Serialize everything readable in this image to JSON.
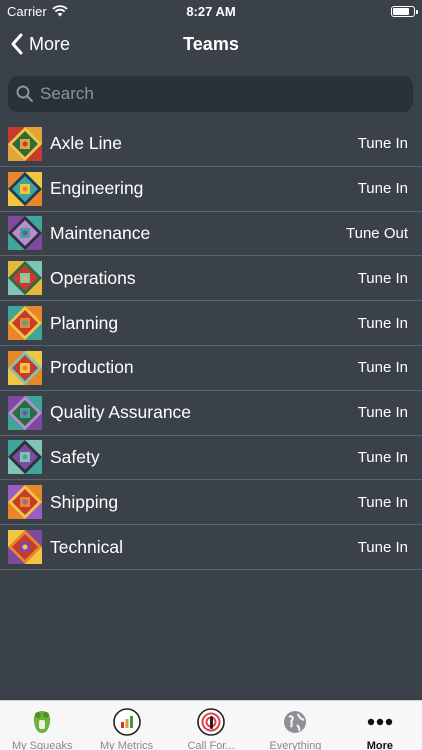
{
  "status_bar": {
    "carrier": "Carrier",
    "time": "8:27 AM"
  },
  "nav": {
    "back_label": "More",
    "title": "Teams"
  },
  "search": {
    "placeholder": "Search",
    "value": ""
  },
  "teams": [
    {
      "name": "Axle Line",
      "action": "Tune In",
      "icon_palette": [
        "#c63a2f",
        "#e3a43a",
        "#2b6b3f",
        "#f2c542"
      ]
    },
    {
      "name": "Engineering",
      "action": "Tune In",
      "icon_palette": [
        "#e8862c",
        "#f2c542",
        "#3fa59b",
        "#1f3b5a"
      ]
    },
    {
      "name": "Maintenance",
      "action": "Tune Out",
      "icon_palette": [
        "#7d4aa0",
        "#3fa59b",
        "#b98bd0",
        "#2d2f35"
      ]
    },
    {
      "name": "Operations",
      "action": "Tune In",
      "icon_palette": [
        "#e7b93b",
        "#7fc5b3",
        "#c63a2f",
        "#2b6b3f"
      ]
    },
    {
      "name": "Planning",
      "action": "Tune In",
      "icon_palette": [
        "#3fa59b",
        "#e8862c",
        "#c63a2f",
        "#f2c542"
      ]
    },
    {
      "name": "Production",
      "action": "Tune In",
      "icon_palette": [
        "#e8862c",
        "#f2c542",
        "#c63a2f",
        "#7fc5b3"
      ]
    },
    {
      "name": "Quality Assurance",
      "action": "Tune In",
      "icon_palette": [
        "#7d4aa0",
        "#3fa59b",
        "#2b6b3f",
        "#b98bd0"
      ]
    },
    {
      "name": "Safety",
      "action": "Tune In",
      "icon_palette": [
        "#3fa59b",
        "#7fc5b3",
        "#7d4aa0",
        "#2d2f35"
      ]
    },
    {
      "name": "Shipping",
      "action": "Tune In",
      "icon_palette": [
        "#9b5ec4",
        "#e8862c",
        "#c63a2f",
        "#f2c542"
      ]
    },
    {
      "name": "Technical",
      "action": "Tune In",
      "icon_palette": [
        "#f2c542",
        "#7d4aa0",
        "#c63a2f",
        "#e8862c"
      ]
    }
  ],
  "tabs": [
    {
      "label": "My Squeaks",
      "icon": "squeaks-icon",
      "active": false
    },
    {
      "label": "My Metrics",
      "icon": "metrics-icon",
      "active": false
    },
    {
      "label": "Call For...",
      "icon": "call-for-icon",
      "active": false
    },
    {
      "label": "Everything",
      "icon": "globe-icon",
      "active": false
    },
    {
      "label": "More",
      "icon": "more-icon",
      "active": true
    }
  ]
}
